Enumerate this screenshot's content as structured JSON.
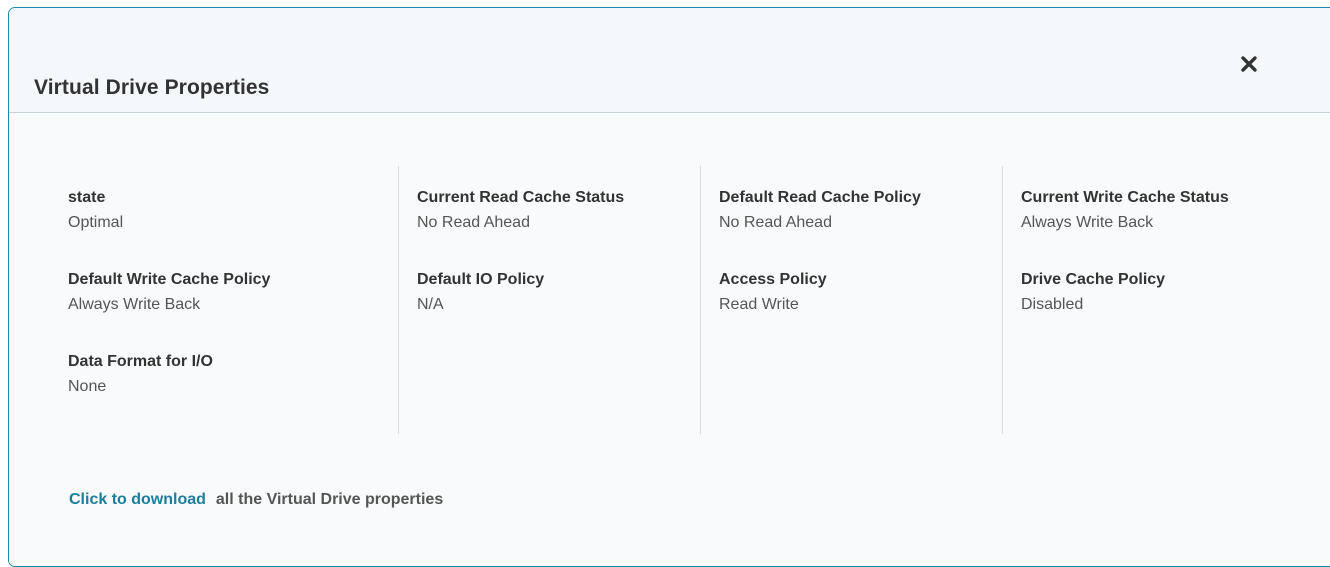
{
  "dialog": {
    "title": "Virtual Drive Properties",
    "close_icon": "close-icon"
  },
  "columns": [
    [
      {
        "name": "state",
        "value": "Optimal"
      },
      {
        "name": "Default Write Cache Policy",
        "value": "Always Write Back"
      },
      {
        "name": "Data Format for I/O",
        "value": "None"
      }
    ],
    [
      {
        "name": "Current Read Cache Status",
        "value": "No Read Ahead"
      },
      {
        "name": "Default IO Policy",
        "value": "N/A"
      }
    ],
    [
      {
        "name": "Default Read Cache Policy",
        "value": "No Read Ahead"
      },
      {
        "name": "Access Policy",
        "value": "Read Write"
      }
    ],
    [
      {
        "name": "Current Write Cache Status",
        "value": "Always Write Back"
      },
      {
        "name": "Drive Cache Policy",
        "value": "Disabled"
      }
    ]
  ],
  "footer": {
    "link_label": "Click to download",
    "text": "all the Virtual Drive properties"
  },
  "colors": {
    "accent": "#1c8aa6",
    "link": "#1c7f99",
    "header_bg": "#f4f8fa"
  }
}
